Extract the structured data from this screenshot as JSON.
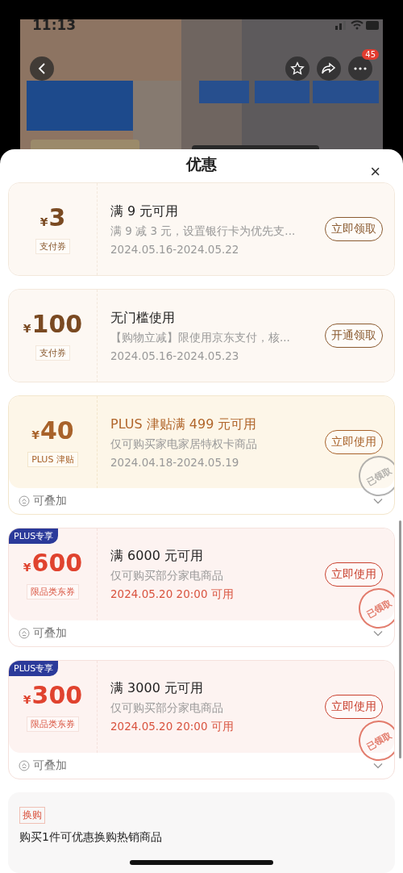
{
  "status_bar": {
    "time": "11:13"
  },
  "top_actions": {
    "badge": "45"
  },
  "sheet": {
    "title": "优惠",
    "close": "×"
  },
  "coupons": [
    {
      "kind": "plain",
      "amount": "3",
      "currency": "¥",
      "tag": "支付券",
      "title": "满 9 元可用",
      "desc": "满 9 减 3 元，设置银行卡为优先支...",
      "date": "2024.05.16-2024.05.22",
      "button": "立即领取"
    },
    {
      "kind": "plain",
      "amount": "100",
      "currency": "¥",
      "tag": "支付券",
      "title": "无门槛使用",
      "desc": "【购物立减】限使用京东支付，核...",
      "date": "2024.05.16-2024.05.23",
      "button": "开通领取"
    },
    {
      "kind": "plus",
      "amount": "40",
      "currency": "¥",
      "tag": "PLUS 津贴",
      "title": "PLUS 津贴满 499 元可用",
      "desc": "仅可购买家电家居特权卡商品",
      "date": "2024.04.18-2024.05.19",
      "button": "立即使用",
      "stamp": "已领取",
      "footer": "可叠加"
    },
    {
      "kind": "red",
      "badge": "PLUS专享",
      "amount": "600",
      "currency": "¥",
      "tag": "限品类东券",
      "title": "满 6000 元可用",
      "desc": "仅可购买部分家电商品",
      "date": "2024.05.20 20:00 可用",
      "button": "立即使用",
      "stamp": "已领取",
      "footer": "可叠加"
    },
    {
      "kind": "red",
      "badge": "PLUS专享",
      "amount": "300",
      "currency": "¥",
      "tag": "限品类东券",
      "title": "满 3000 元可用",
      "desc": "仅可购买部分家电商品",
      "date": "2024.05.20 20:00 可用",
      "button": "立即使用",
      "stamp": "已领取",
      "footer": "可叠加"
    }
  ],
  "offer": {
    "tag": "换购",
    "text": "购买1件可优惠换购热销商品"
  }
}
